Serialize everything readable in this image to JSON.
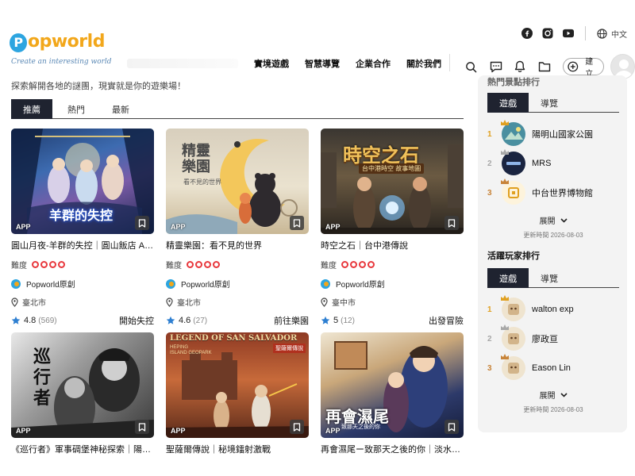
{
  "header": {
    "logo_text": "opworld",
    "logo_letter": "P",
    "logo_tagline": "Create an interesting world",
    "nav": [
      "實境遊戲",
      "智慧導覽",
      "企業合作",
      "關於我們"
    ],
    "language": "中文",
    "create_label": "建立"
  },
  "tagline": "探索解開各地的謎團，現實就是你的遊樂場！",
  "tabs": [
    "推薦",
    "熱門",
    "最新"
  ],
  "app_badge": "APP",
  "difficulty_label": "難度",
  "cards": [
    {
      "title": "圓山月夜-羊群的失控｜圓山飯店 AR…",
      "creator": "Popworld原創",
      "location": "臺北市",
      "rating": "4.8",
      "count": "(569)",
      "cta": "開始失控",
      "difficulty": 4
    },
    {
      "title": "精靈樂園：看不見的世界",
      "creator": "Popworld原創",
      "location": "臺北市",
      "rating": "4.6",
      "count": "(27)",
      "cta": "前往樂園",
      "difficulty": 4
    },
    {
      "title": "時空之石｜台中港傳說",
      "creator": "Popworld原創",
      "location": "臺中市",
      "rating": "5",
      "count": "(12)",
      "cta": "出發冒險",
      "difficulty": 4
    },
    {
      "title": "《巡行者》軍事碉堡神秘探索｜陽明…"
    },
    {
      "title": "聖薩爾傳說｜秘境鐳射激戰"
    },
    {
      "title": "再會濕尾ー致那天之後的你｜淡水老…"
    }
  ],
  "thumb_text": {
    "card1": "羊群的失控",
    "card2_title": "精靈\n樂園",
    "card2_sub": "看不見的世界",
    "card3_title": "時空之石",
    "card3_sub": "台中港時空 故事地圖",
    "card4_title": "巡行者",
    "card5_title": "LEGEND OF SAN SALVADOR",
    "card5_sub": "HEPING\nISLAND GEOPARK",
    "card5_tag": "聖薩爾傳說",
    "card6_title": "再會濕尾",
    "card6_sub": "致那天之後的你"
  },
  "sidebar": {
    "section1_title": "熱門景點排行",
    "section2_title": "活躍玩家排行",
    "tabs": [
      "遊戲",
      "導覽"
    ],
    "spots": [
      {
        "rank": "1",
        "name": "陽明山國家公園"
      },
      {
        "rank": "2",
        "name": "MRS"
      },
      {
        "rank": "3",
        "name": "中台世界博物館"
      }
    ],
    "players": [
      {
        "rank": "1",
        "name": "walton exp"
      },
      {
        "rank": "2",
        "name": "廖政亘"
      },
      {
        "rank": "3",
        "name": "Eason Lin"
      }
    ],
    "expand_label": "展開",
    "updated_label": "更新時間 2026-08-03"
  },
  "colors": {
    "brand_blue": "#2da5e0",
    "brand_orange": "#f2a71b",
    "tab_active": "#1f2330",
    "difficulty_red": "#e8383d",
    "star_blue": "#2e7fd1",
    "rank_gold": "#e0a020",
    "rank_silver": "#a8a8a8",
    "rank_bronze": "#c8843a"
  }
}
